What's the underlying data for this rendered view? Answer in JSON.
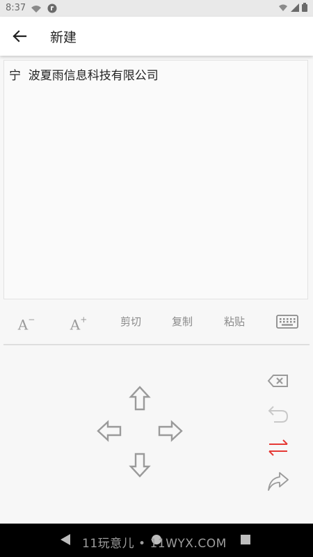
{
  "status_bar": {
    "time": "8:37",
    "left_icons": [
      "wifi-icon",
      "app-notification-icon"
    ],
    "right_icons": [
      "wifi-signal-icon",
      "cell-signal-icon",
      "battery-icon"
    ]
  },
  "app_bar": {
    "title": "新建",
    "back_icon": "arrow-left-icon"
  },
  "editor": {
    "content": "宁  波夏雨信息科技有限公司"
  },
  "toolbar": {
    "font_decrease": "A",
    "font_decrease_sup": "−",
    "font_increase": "A",
    "font_increase_sup": "+",
    "cut": "剪切",
    "copy": "复制",
    "paste": "粘贴",
    "keyboard_icon": "keyboard-icon"
  },
  "pad": {
    "arrows": [
      "arrow-up-icon",
      "arrow-left-icon",
      "arrow-right-icon",
      "arrow-down-icon"
    ],
    "actions": [
      "backspace-icon",
      "undo-icon",
      "switch-icon",
      "redo-icon"
    ],
    "accent_color": "#e53935",
    "icon_color": "#9a9a9a"
  },
  "nav_bar": {
    "watermark": "11玩意儿 • 11WYX.COM"
  }
}
